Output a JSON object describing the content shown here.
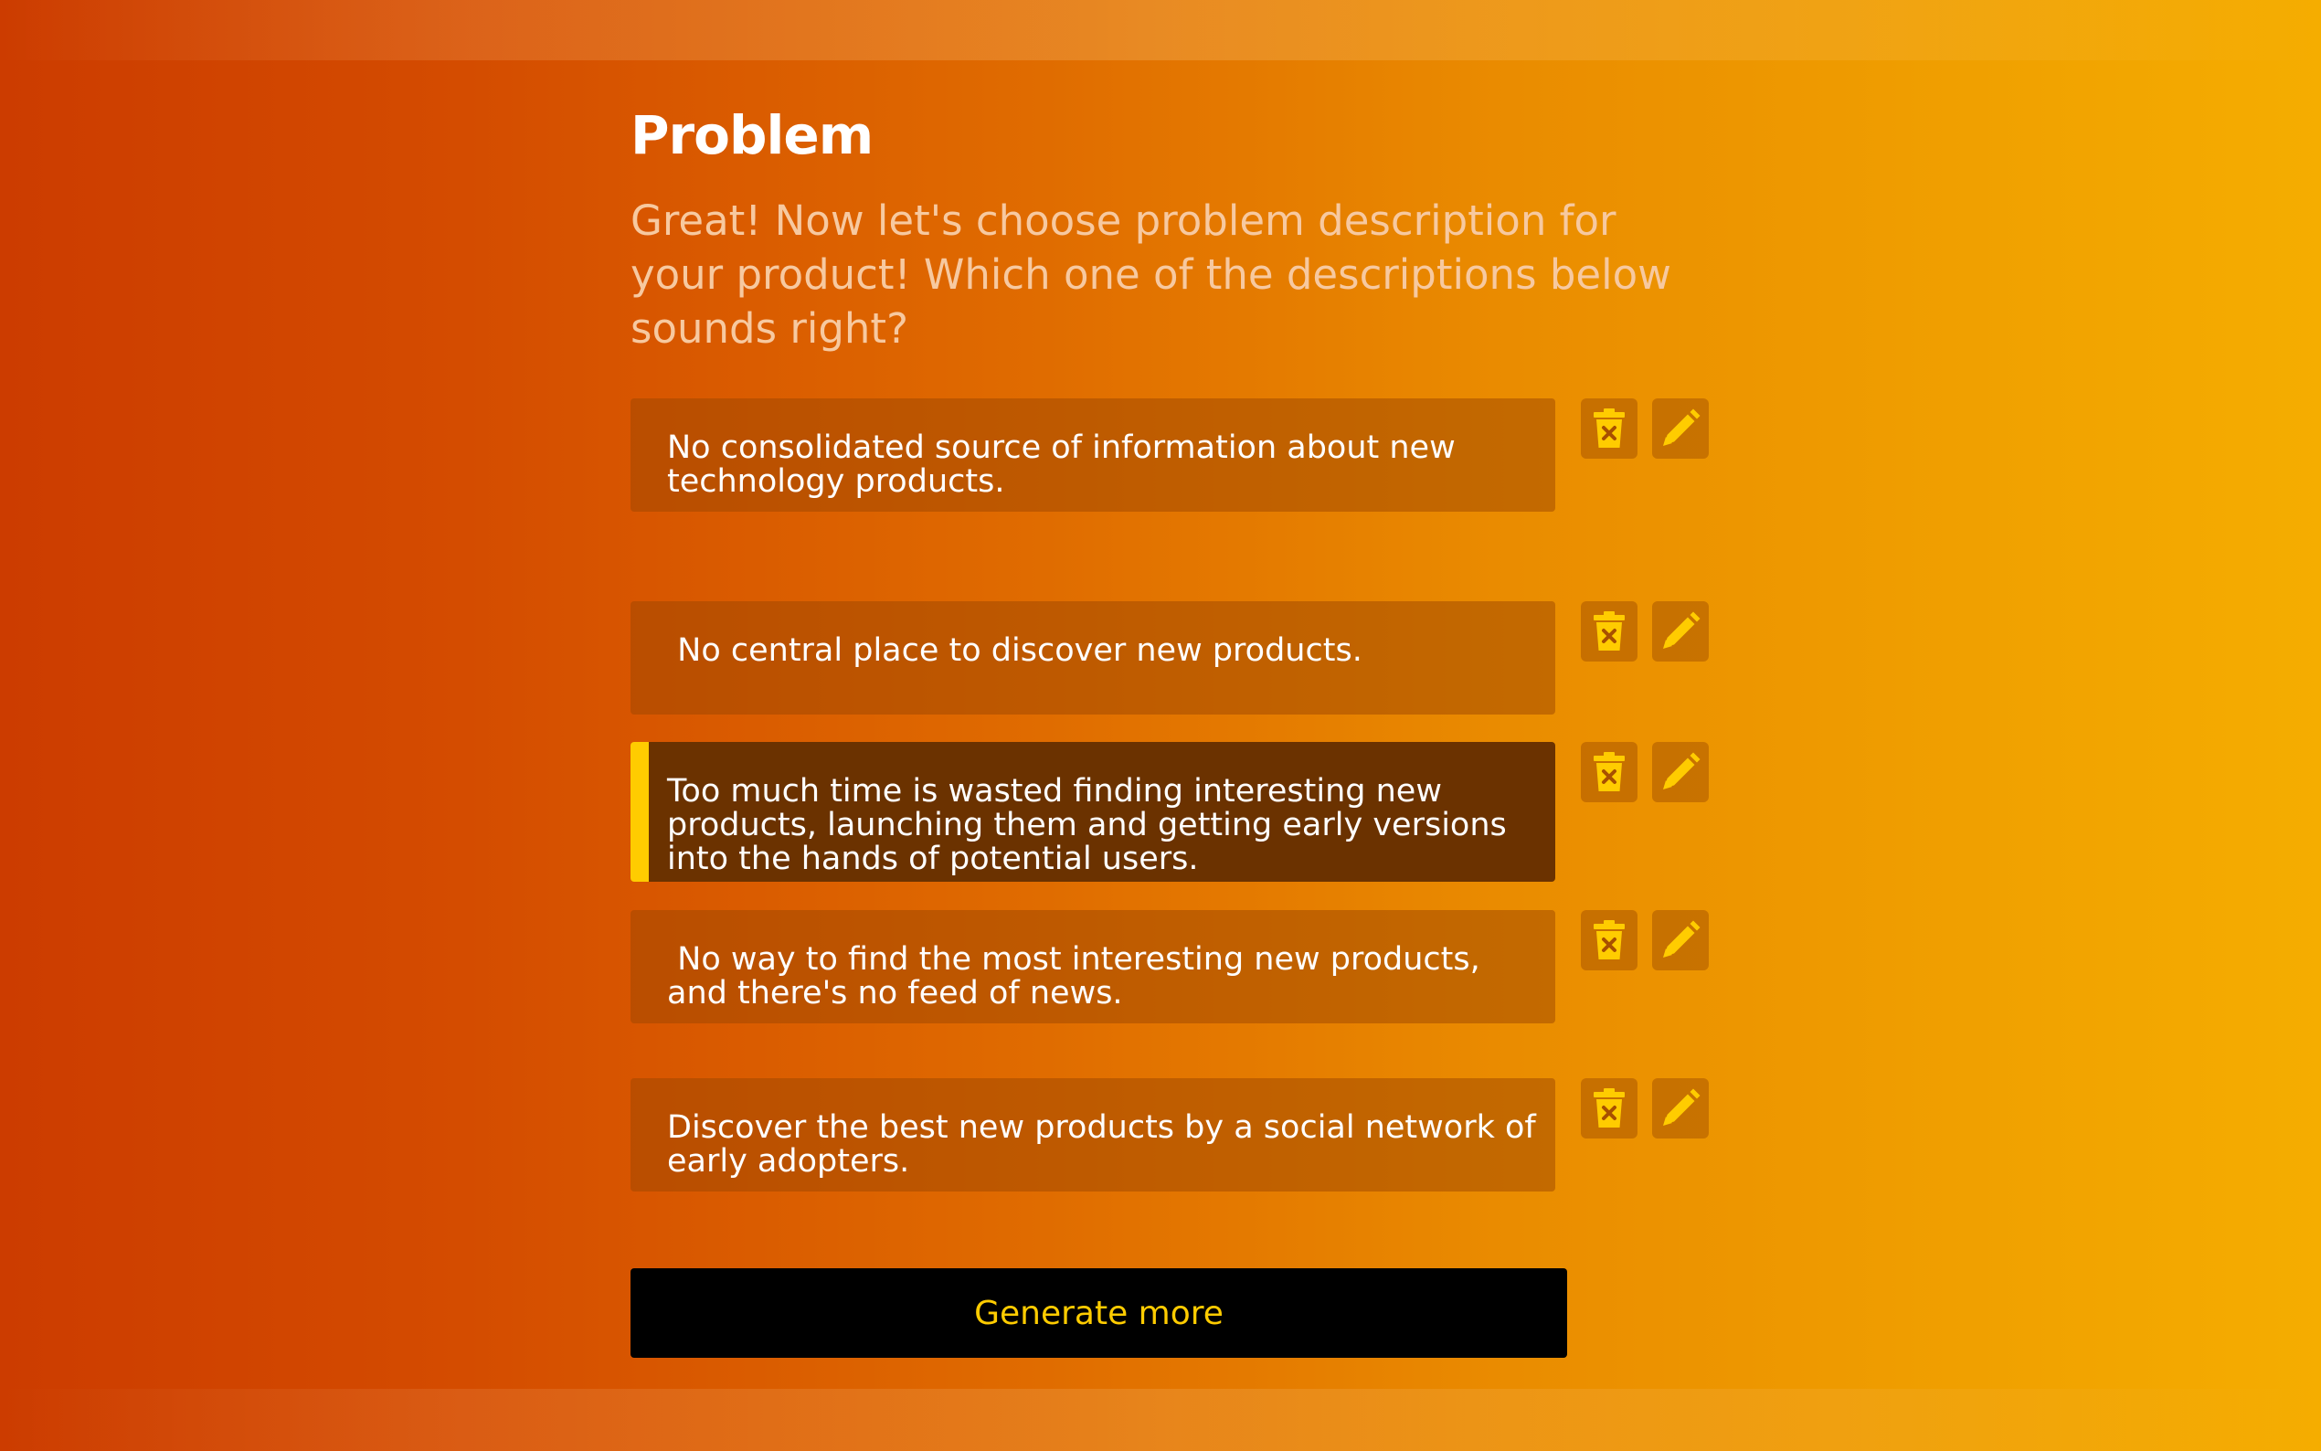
{
  "page": {
    "title": "Problem",
    "subtitle": "Great! Now let's choose problem description for your product! Which one of the descriptions below sounds right?"
  },
  "options": [
    {
      "text": "No consolidated source of information about new technology products.",
      "selected": false
    },
    {
      "text": " No central place to discover new products.",
      "selected": false
    },
    {
      "text": "Too much time is wasted finding interesting new products, launching them and getting early versions into the hands of potential users.",
      "selected": true
    },
    {
      "text": " No way to find the most interesting new products, and there's no feed of news.",
      "selected": false
    },
    {
      "text": "Discover the best new products by a social network of early adopters.",
      "selected": false
    }
  ],
  "icons": {
    "delete": "trash-icon",
    "edit": "pencil-icon"
  },
  "actions": {
    "generate_label": "Generate more"
  },
  "colors": {
    "accent": "#ffcc00",
    "button_bg": "#000000",
    "selected_bg": "#6b3200",
    "option_bg": "#b35a00"
  }
}
